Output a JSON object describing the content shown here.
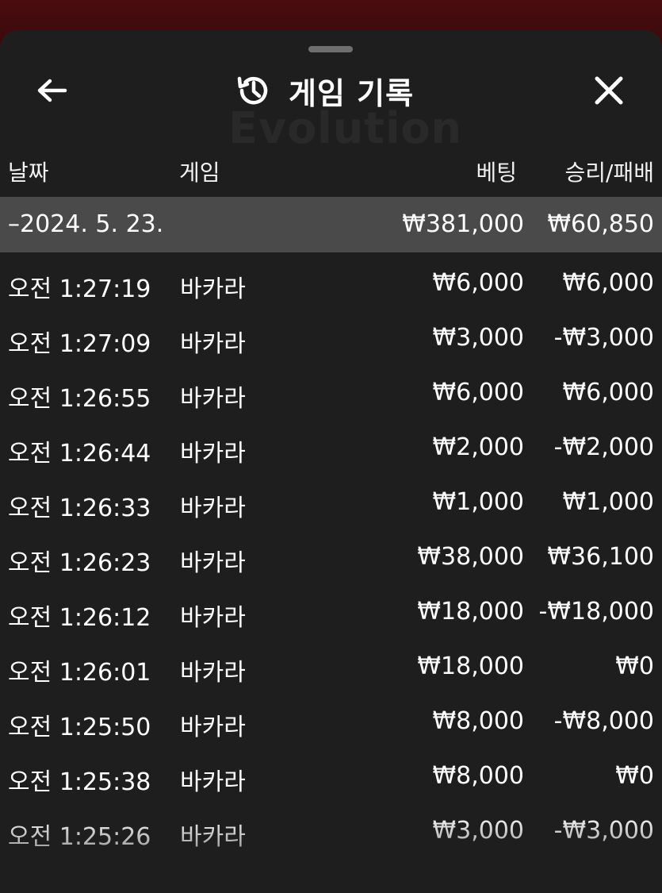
{
  "header": {
    "title": "게임 기록",
    "back_icon": "arrow-left-icon",
    "history_icon": "history-clock-icon",
    "close_icon": "close-icon"
  },
  "watermark": "Evolution",
  "columns": {
    "date": "날짜",
    "game": "게임",
    "bet": "베팅",
    "result": "승리/패배"
  },
  "day": {
    "date": "–2024. 5. 23.",
    "bet_total": "₩381,000",
    "result_total": "₩60,850"
  },
  "rows": [
    {
      "time": "오전 1:27:19",
      "game": "바카라",
      "bet": "₩6,000",
      "result": "₩6,000"
    },
    {
      "time": "오전 1:27:09",
      "game": "바카라",
      "bet": "₩3,000",
      "result": "-₩3,000"
    },
    {
      "time": "오전 1:26:55",
      "game": "바카라",
      "bet": "₩6,000",
      "result": "₩6,000"
    },
    {
      "time": "오전 1:26:44",
      "game": "바카라",
      "bet": "₩2,000",
      "result": "-₩2,000"
    },
    {
      "time": "오전 1:26:33",
      "game": "바카라",
      "bet": "₩1,000",
      "result": "₩1,000"
    },
    {
      "time": "오전 1:26:23",
      "game": "바카라",
      "bet": "₩38,000",
      "result": "₩36,100"
    },
    {
      "time": "오전 1:26:12",
      "game": "바카라",
      "bet": "₩18,000",
      "result": "-₩18,000"
    },
    {
      "time": "오전 1:26:01",
      "game": "바카라",
      "bet": "₩18,000",
      "result": "₩0"
    },
    {
      "time": "오전 1:25:50",
      "game": "바카라",
      "bet": "₩8,000",
      "result": "-₩8,000"
    },
    {
      "time": "오전 1:25:38",
      "game": "바카라",
      "bet": "₩8,000",
      "result": "₩0"
    },
    {
      "time": "오전 1:25:26",
      "game": "바카라",
      "bet": "₩3,000",
      "result": "-₩3,000"
    }
  ]
}
